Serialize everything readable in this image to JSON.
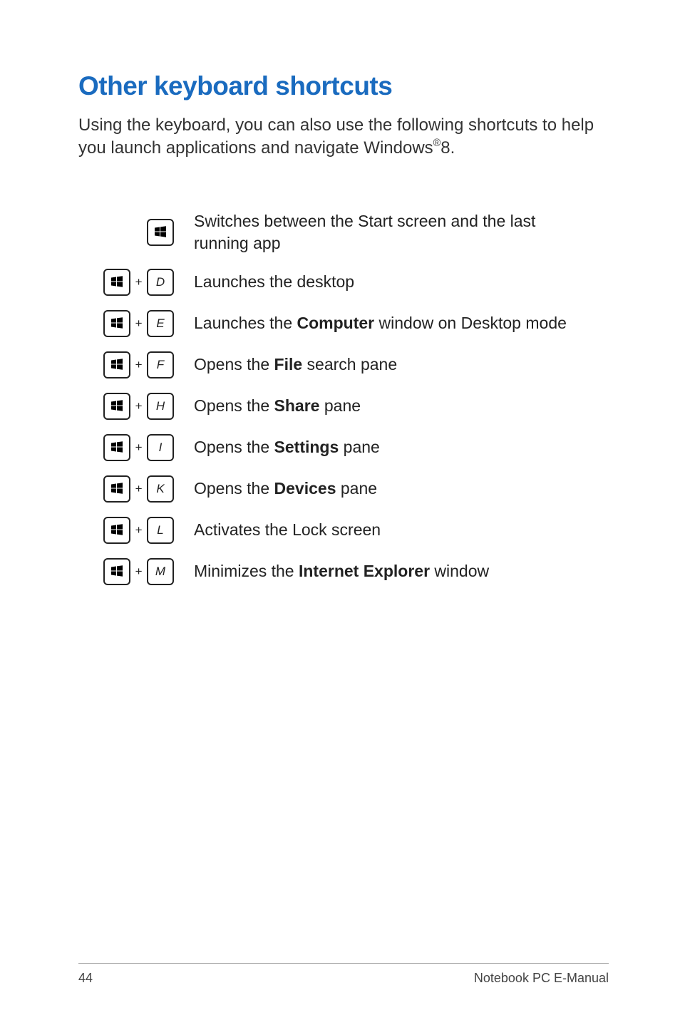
{
  "heading": "Other keyboard shortcuts",
  "intro_pre": "Using the keyboard, you can also use the following shortcuts to help you launch applications and navigate Windows",
  "intro_reg": "®",
  "intro_post": "8.",
  "plus": "+",
  "shortcuts": [
    {
      "combo": "win",
      "letter": "",
      "desc_pre": "Switches between the Start screen and the last running app",
      "bold": "",
      "desc_post": ""
    },
    {
      "combo": "win+key",
      "letter": "D",
      "desc_pre": "Launches the desktop",
      "bold": "",
      "desc_post": ""
    },
    {
      "combo": "win+key",
      "letter": "E",
      "desc_pre": "Launches the ",
      "bold": "Computer",
      "desc_post": " window on Desktop mode"
    },
    {
      "combo": "win+key",
      "letter": "F",
      "desc_pre": "Opens the ",
      "bold": "File",
      "desc_post": " search pane"
    },
    {
      "combo": "win+key",
      "letter": "H",
      "desc_pre": "Opens the ",
      "bold": "Share",
      "desc_post": " pane"
    },
    {
      "combo": "win+key",
      "letter": "I",
      "desc_pre": "Opens the ",
      "bold": "Settings",
      "desc_post": " pane"
    },
    {
      "combo": "win+key",
      "letter": "K",
      "desc_pre": "Opens the ",
      "bold": "Devices",
      "desc_post": " pane"
    },
    {
      "combo": "win+key",
      "letter": "L",
      "desc_pre": "Activates the Lock screen",
      "bold": "",
      "desc_post": ""
    },
    {
      "combo": "win+key",
      "letter": "M",
      "desc_pre": "Minimizes the ",
      "bold": "Internet Explorer",
      "desc_post": " window"
    }
  ],
  "footer": {
    "page": "44",
    "title": "Notebook PC E-Manual"
  }
}
